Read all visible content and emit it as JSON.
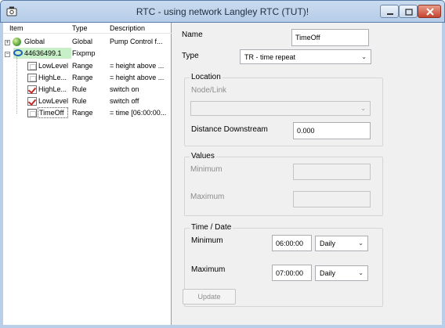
{
  "window": {
    "title": "RTC -  using network Langley RTC (TUT)!",
    "min_symbol": "–",
    "max_symbol": "□",
    "close_symbol": "✕"
  },
  "tree": {
    "headers": {
      "item": "Item",
      "type": "Type",
      "description": "Description"
    },
    "rows": [
      {
        "item": "Global",
        "type": "Global",
        "description": "Pump Control f...",
        "expander": "+"
      },
      {
        "item": "44636499.1",
        "type": "Fixpmp",
        "description": "",
        "expander": "−"
      },
      {
        "item": "LowLevel",
        "type": "Range",
        "description": "= height above ..."
      },
      {
        "item": "HighLe...",
        "type": "Range",
        "description": "= height above ..."
      },
      {
        "item": "HighLe...",
        "type": "Rule",
        "description": "switch on"
      },
      {
        "item": "LowLevel",
        "type": "Rule",
        "description": "switch off"
      },
      {
        "item": "TimeOff",
        "type": "Range",
        "description": "= time [06:00:00..."
      }
    ]
  },
  "form": {
    "name_label": "Name",
    "name_value": "TimeOff",
    "type_label": "Type",
    "type_value": "TR - time repeat",
    "location": {
      "title": "Location",
      "node_link_label": "Node/Link",
      "node_link_value": "",
      "distance_label": "Distance Downstream",
      "distance_value": "0.000"
    },
    "values": {
      "title": "Values",
      "minimum_label": "Minimum",
      "minimum_value": "",
      "maximum_label": "Maximum",
      "maximum_value": ""
    },
    "time_date": {
      "title": "Time / Date",
      "minimum_label": "Minimum",
      "minimum_time": "06:00:00",
      "minimum_period": "Daily",
      "maximum_label": "Maximum",
      "maximum_time": "07:00:00",
      "maximum_period": "Daily"
    },
    "update_label": "Update"
  }
}
